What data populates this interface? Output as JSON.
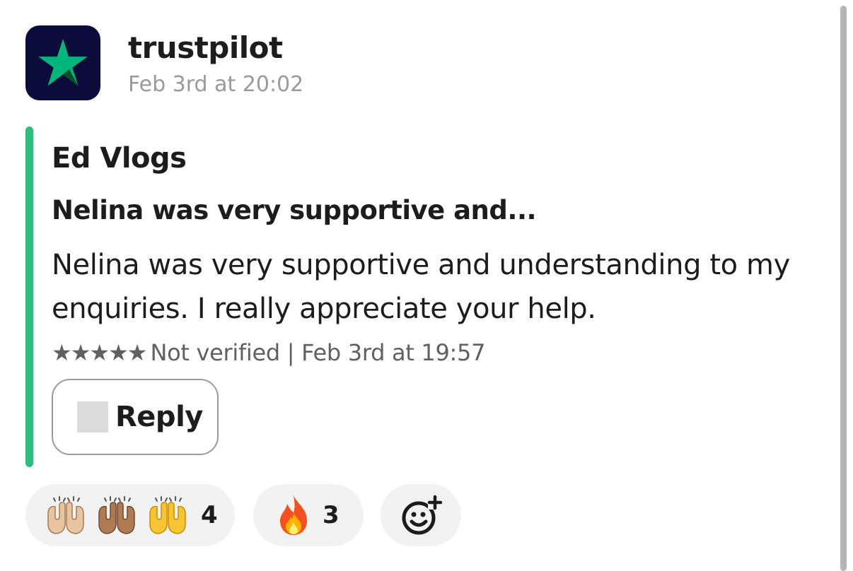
{
  "message": {
    "sender": "trustpilot",
    "timestamp": "Feb 3rd at 20:02",
    "avatar_icon": "star-icon",
    "avatar_colors": {
      "background": "#0b0c3a",
      "star": "#00b67a"
    }
  },
  "attachment": {
    "bar_color": "#2ebd7f",
    "reviewer": "Ed Vlogs",
    "title": "Nelina was very supportive and...",
    "body": "Nelina was very supportive and understanding to my enquiries. I really appreciate your help.",
    "stars": "★★★★★",
    "meta": "Not verified | Feb 3rd at 19:57",
    "reply_label": "Reply"
  },
  "reactions": [
    {
      "emojis": [
        "raising-hands-light-skin",
        "raising-hands-medium-skin",
        "raising-hands-yellow"
      ],
      "count": "4"
    },
    {
      "emojis": [
        "fire"
      ],
      "count": "3"
    }
  ],
  "add_reaction_icon": "add-reaction-icon"
}
